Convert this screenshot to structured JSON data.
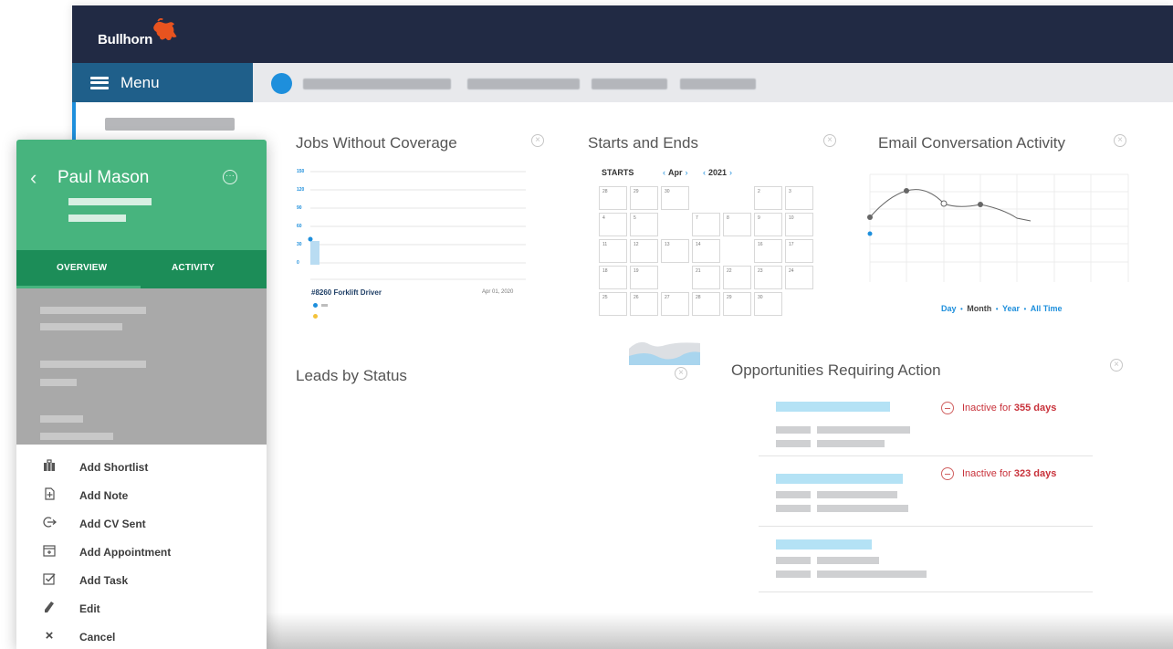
{
  "app": {
    "logo_text": "Bullhorn",
    "menu_label": "Menu"
  },
  "widgets": {
    "jobs": {
      "title": "Jobs Without Coverage",
      "yticks": [
        "150",
        "120",
        "90",
        "60",
        "30",
        "0"
      ],
      "job_name": "#8260 Forklift Driver",
      "job_date": "Apr 01, 2020"
    },
    "starts": {
      "title": "Starts and Ends",
      "header": "STARTS",
      "month": "Apr",
      "year": "2021",
      "days": [
        [
          "28",
          "29",
          "30",
          "",
          "",
          "2",
          "3"
        ],
        [
          "4",
          "5",
          "",
          "7",
          "8",
          "9",
          "10"
        ],
        [
          "11",
          "12",
          "13",
          "14",
          "",
          "16",
          "17"
        ],
        [
          "18",
          "19",
          "",
          "21",
          "22",
          "23",
          "24"
        ],
        [
          "25",
          "26",
          "27",
          "28",
          "29",
          "30",
          ""
        ]
      ]
    },
    "email": {
      "title": "Email Conversation Activity",
      "range_day": "Day",
      "range_month": "Month",
      "range_year": "Year",
      "range_all": "All Time"
    },
    "leads": {
      "title": "Leads by Status"
    },
    "opps": {
      "title": "Opportunities Requiring Action",
      "rows": [
        {
          "prefix": "Inactive for",
          "days": "355 days"
        },
        {
          "prefix": "Inactive for",
          "days": "323 days"
        }
      ]
    }
  },
  "panel": {
    "name": "Paul Mason",
    "tab_overview": "OVERVIEW",
    "tab_activity": "ACTIVITY",
    "actions": [
      {
        "label": "Add Shortlist",
        "icon": "briefcase-icon"
      },
      {
        "label": "Add Note",
        "icon": "note-icon"
      },
      {
        "label": "Add CV Sent",
        "icon": "cv-sent-icon"
      },
      {
        "label": "Add Appointment",
        "icon": "calendar-icon"
      },
      {
        "label": "Add Task",
        "icon": "checkbox-icon"
      },
      {
        "label": "Edit",
        "icon": "pencil-icon"
      },
      {
        "label": "Cancel",
        "icon": "close-icon"
      }
    ]
  },
  "colors": {
    "topbar": "#212a44",
    "menu": "#1f5f8a",
    "accent": "#1e8fdc",
    "panel_green": "#47b47e",
    "tab_green": "#1c8d58",
    "alert_red": "#c8313a"
  }
}
